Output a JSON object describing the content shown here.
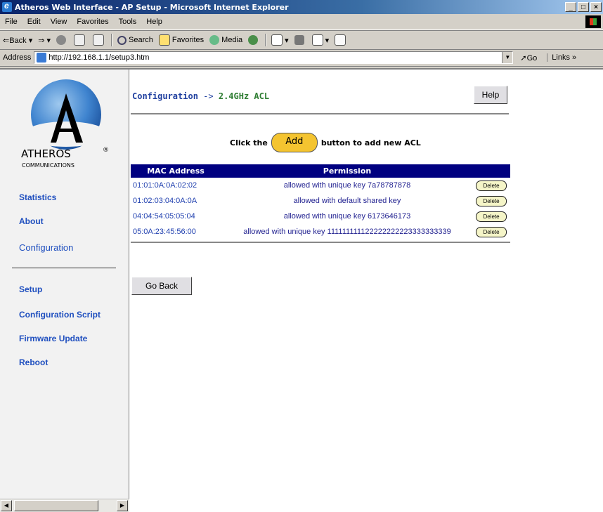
{
  "window": {
    "title": "Atheros Web Interface - AP Setup - Microsoft Internet Explorer",
    "controls": [
      "_",
      "□",
      "×"
    ]
  },
  "menu": [
    "File",
    "Edit",
    "View",
    "Favorites",
    "Tools",
    "Help"
  ],
  "toolbar": {
    "back": "⇐Back",
    "forward": "⇒",
    "search": "Search",
    "favorites": "Favorites",
    "media": "Media"
  },
  "address": {
    "label": "Address",
    "url": "http://192.168.1.1/setup3.htm",
    "go": "Go",
    "links": "Links"
  },
  "sidebar": {
    "brand": "ATHEROS",
    "brand_reg": "®",
    "brand_sub": "COMMUNICATIONS",
    "items": {
      "statistics": "Statistics",
      "about": "About",
      "configuration": "Configuration",
      "setup": "Setup",
      "config_script": "Configuration Script",
      "firmware": "Firmware Update",
      "reboot": "Reboot"
    }
  },
  "main": {
    "breadcrumb_root": "Configuration",
    "breadcrumb_arrow": "->",
    "breadcrumb_current": "2.4GHz ACL",
    "help": "Help",
    "instruction_pre": "Click the",
    "add": "Add",
    "instruction_post": "button to add new ACL",
    "table": {
      "headers": [
        "MAC Address",
        "Permission"
      ],
      "rows": [
        {
          "mac": "01:01:0A:0A:02:02",
          "perm": "allowed with unique key 7a78787878",
          "action": "Delete"
        },
        {
          "mac": "01:02:03:04:0A:0A",
          "perm": "allowed with default shared key",
          "action": "Delete"
        },
        {
          "mac": "04:04:54:05:05:04",
          "perm": "allowed with unique key 6173646173",
          "action": "Delete"
        },
        {
          "mac": "05:0A:23:45:56:00",
          "perm": "allowed with unique key 111111111122222222223333333339",
          "action": "Delete"
        }
      ]
    },
    "go_back": "Go Back"
  }
}
